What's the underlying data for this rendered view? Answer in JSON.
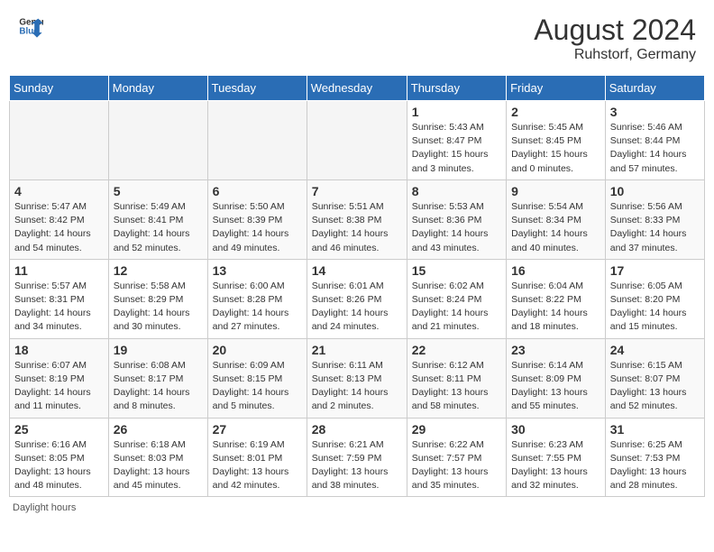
{
  "header": {
    "logo_general": "General",
    "logo_blue": "Blue",
    "month_year": "August 2024",
    "location": "Ruhstorf, Germany"
  },
  "days_of_week": [
    "Sunday",
    "Monday",
    "Tuesday",
    "Wednesday",
    "Thursday",
    "Friday",
    "Saturday"
  ],
  "footer": {
    "daylight_label": "Daylight hours"
  },
  "weeks": [
    {
      "days": [
        {
          "num": "",
          "detail": ""
        },
        {
          "num": "",
          "detail": ""
        },
        {
          "num": "",
          "detail": ""
        },
        {
          "num": "",
          "detail": ""
        },
        {
          "num": "1",
          "detail": "Sunrise: 5:43 AM\nSunset: 8:47 PM\nDaylight: 15 hours\nand 3 minutes."
        },
        {
          "num": "2",
          "detail": "Sunrise: 5:45 AM\nSunset: 8:45 PM\nDaylight: 15 hours\nand 0 minutes."
        },
        {
          "num": "3",
          "detail": "Sunrise: 5:46 AM\nSunset: 8:44 PM\nDaylight: 14 hours\nand 57 minutes."
        }
      ]
    },
    {
      "days": [
        {
          "num": "4",
          "detail": "Sunrise: 5:47 AM\nSunset: 8:42 PM\nDaylight: 14 hours\nand 54 minutes."
        },
        {
          "num": "5",
          "detail": "Sunrise: 5:49 AM\nSunset: 8:41 PM\nDaylight: 14 hours\nand 52 minutes."
        },
        {
          "num": "6",
          "detail": "Sunrise: 5:50 AM\nSunset: 8:39 PM\nDaylight: 14 hours\nand 49 minutes."
        },
        {
          "num": "7",
          "detail": "Sunrise: 5:51 AM\nSunset: 8:38 PM\nDaylight: 14 hours\nand 46 minutes."
        },
        {
          "num": "8",
          "detail": "Sunrise: 5:53 AM\nSunset: 8:36 PM\nDaylight: 14 hours\nand 43 minutes."
        },
        {
          "num": "9",
          "detail": "Sunrise: 5:54 AM\nSunset: 8:34 PM\nDaylight: 14 hours\nand 40 minutes."
        },
        {
          "num": "10",
          "detail": "Sunrise: 5:56 AM\nSunset: 8:33 PM\nDaylight: 14 hours\nand 37 minutes."
        }
      ]
    },
    {
      "days": [
        {
          "num": "11",
          "detail": "Sunrise: 5:57 AM\nSunset: 8:31 PM\nDaylight: 14 hours\nand 34 minutes."
        },
        {
          "num": "12",
          "detail": "Sunrise: 5:58 AM\nSunset: 8:29 PM\nDaylight: 14 hours\nand 30 minutes."
        },
        {
          "num": "13",
          "detail": "Sunrise: 6:00 AM\nSunset: 8:28 PM\nDaylight: 14 hours\nand 27 minutes."
        },
        {
          "num": "14",
          "detail": "Sunrise: 6:01 AM\nSunset: 8:26 PM\nDaylight: 14 hours\nand 24 minutes."
        },
        {
          "num": "15",
          "detail": "Sunrise: 6:02 AM\nSunset: 8:24 PM\nDaylight: 14 hours\nand 21 minutes."
        },
        {
          "num": "16",
          "detail": "Sunrise: 6:04 AM\nSunset: 8:22 PM\nDaylight: 14 hours\nand 18 minutes."
        },
        {
          "num": "17",
          "detail": "Sunrise: 6:05 AM\nSunset: 8:20 PM\nDaylight: 14 hours\nand 15 minutes."
        }
      ]
    },
    {
      "days": [
        {
          "num": "18",
          "detail": "Sunrise: 6:07 AM\nSunset: 8:19 PM\nDaylight: 14 hours\nand 11 minutes."
        },
        {
          "num": "19",
          "detail": "Sunrise: 6:08 AM\nSunset: 8:17 PM\nDaylight: 14 hours\nand 8 minutes."
        },
        {
          "num": "20",
          "detail": "Sunrise: 6:09 AM\nSunset: 8:15 PM\nDaylight: 14 hours\nand 5 minutes."
        },
        {
          "num": "21",
          "detail": "Sunrise: 6:11 AM\nSunset: 8:13 PM\nDaylight: 14 hours\nand 2 minutes."
        },
        {
          "num": "22",
          "detail": "Sunrise: 6:12 AM\nSunset: 8:11 PM\nDaylight: 13 hours\nand 58 minutes."
        },
        {
          "num": "23",
          "detail": "Sunrise: 6:14 AM\nSunset: 8:09 PM\nDaylight: 13 hours\nand 55 minutes."
        },
        {
          "num": "24",
          "detail": "Sunrise: 6:15 AM\nSunset: 8:07 PM\nDaylight: 13 hours\nand 52 minutes."
        }
      ]
    },
    {
      "days": [
        {
          "num": "25",
          "detail": "Sunrise: 6:16 AM\nSunset: 8:05 PM\nDaylight: 13 hours\nand 48 minutes."
        },
        {
          "num": "26",
          "detail": "Sunrise: 6:18 AM\nSunset: 8:03 PM\nDaylight: 13 hours\nand 45 minutes."
        },
        {
          "num": "27",
          "detail": "Sunrise: 6:19 AM\nSunset: 8:01 PM\nDaylight: 13 hours\nand 42 minutes."
        },
        {
          "num": "28",
          "detail": "Sunrise: 6:21 AM\nSunset: 7:59 PM\nDaylight: 13 hours\nand 38 minutes."
        },
        {
          "num": "29",
          "detail": "Sunrise: 6:22 AM\nSunset: 7:57 PM\nDaylight: 13 hours\nand 35 minutes."
        },
        {
          "num": "30",
          "detail": "Sunrise: 6:23 AM\nSunset: 7:55 PM\nDaylight: 13 hours\nand 32 minutes."
        },
        {
          "num": "31",
          "detail": "Sunrise: 6:25 AM\nSunset: 7:53 PM\nDaylight: 13 hours\nand 28 minutes."
        }
      ]
    }
  ]
}
